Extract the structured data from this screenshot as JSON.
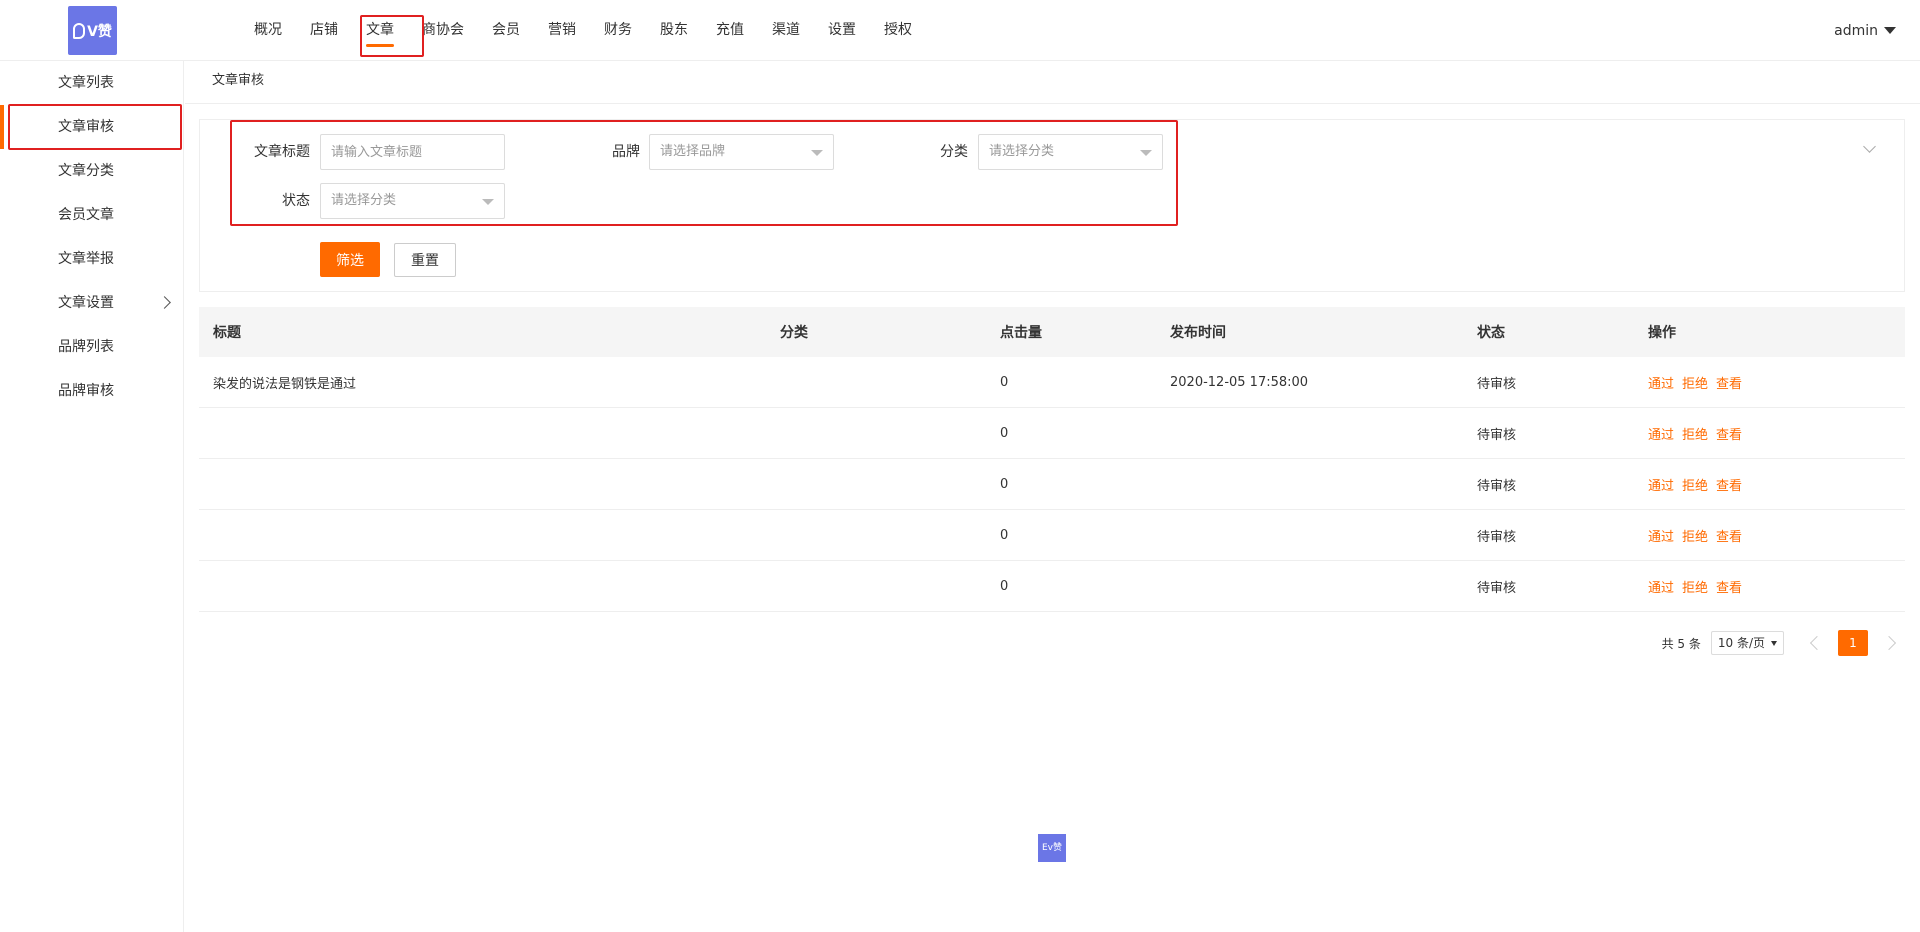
{
  "brand": {
    "logo_text": "V赞",
    "mini_logo_text": "Ev赞",
    "color": "#6b76e6"
  },
  "accent_color": "#ff6a00",
  "nav": {
    "items": [
      "概况",
      "店铺",
      "文章",
      "商协会",
      "会员",
      "营销",
      "财务",
      "股东",
      "充值",
      "渠道",
      "设置",
      "授权"
    ],
    "active": "文章"
  },
  "user": {
    "name": "admin"
  },
  "sidebar": {
    "items": [
      {
        "label": "文章列表"
      },
      {
        "label": "文章审核",
        "active": true
      },
      {
        "label": "文章分类"
      },
      {
        "label": "会员文章"
      },
      {
        "label": "文章举报"
      },
      {
        "label": "文章设置",
        "has_submenu": true
      },
      {
        "label": "品牌列表"
      },
      {
        "label": "品牌审核"
      }
    ]
  },
  "breadcrumb": "文章审核",
  "filter": {
    "title_label": "文章标题",
    "title_placeholder": "请输入文章标题",
    "brand_label": "品牌",
    "brand_placeholder": "请选择品牌",
    "category_label": "分类",
    "category_placeholder": "请选择分类",
    "status_label": "状态",
    "status_placeholder": "请选择分类",
    "submit_label": "筛选",
    "reset_label": "重置"
  },
  "table": {
    "headers": [
      "标题",
      "分类",
      "点击量",
      "发布时间",
      "状态",
      "操作"
    ],
    "rows": [
      {
        "title": "染发的说法是钢铁是通过",
        "category": "",
        "clicks": "0",
        "time": "2020-12-05 17:58:00",
        "status": "待审核"
      },
      {
        "title": "",
        "category": "",
        "clicks": "0",
        "time": "",
        "status": "待审核"
      },
      {
        "title": "",
        "category": "",
        "clicks": "0",
        "time": "",
        "status": "待审核"
      },
      {
        "title": "",
        "category": "",
        "clicks": "0",
        "time": "",
        "status": "待审核"
      },
      {
        "title": "",
        "category": "",
        "clicks": "0",
        "time": "",
        "status": "待审核"
      }
    ],
    "actions": [
      "通过",
      "拒绝",
      "查看"
    ]
  },
  "pagination": {
    "total": "共 5 条",
    "page_size": "10 条/页",
    "current": "1"
  }
}
